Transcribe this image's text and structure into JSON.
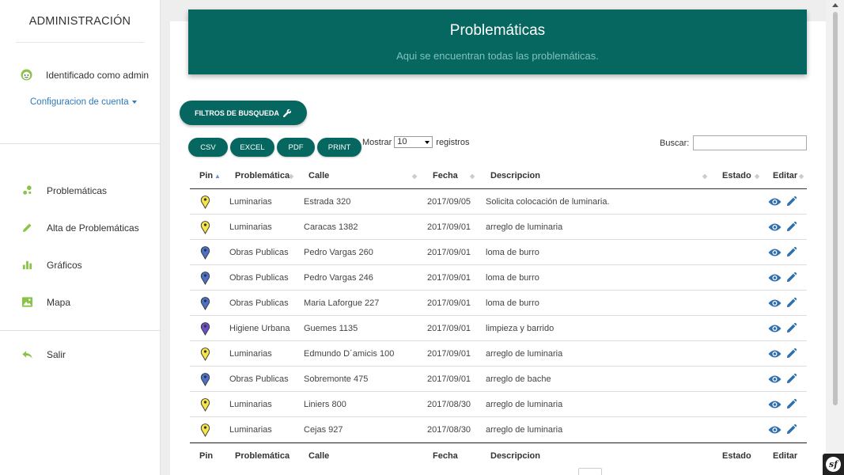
{
  "sidebar": {
    "brand": "ADMINISTRACIÓN",
    "user_label": "Identificado como admin",
    "config_label": "Configuracion de cuenta",
    "nav": [
      {
        "label": "Problemáticas",
        "icon": "dots-icon"
      },
      {
        "label": "Alta de Problemáticas",
        "icon": "pencil-icon"
      },
      {
        "label": "Gráficos",
        "icon": "bar-chart-icon"
      },
      {
        "label": "Mapa",
        "icon": "image-icon"
      }
    ],
    "logout_label": "Salir"
  },
  "header": {
    "title": "Problemáticas",
    "subtitle": "Aqui se encuentran todas las problemáticas."
  },
  "toolbar": {
    "filters_label": "FILTROS DE BUSQUEDA",
    "export_buttons": [
      "CSV",
      "EXCEL",
      "PDF",
      "PRINT"
    ],
    "show_prefix": "Mostrar",
    "show_value": "10",
    "show_suffix": "registros",
    "search_label": "Buscar:",
    "search_value": ""
  },
  "table": {
    "columns": [
      "Pin",
      "Problemática",
      "Calle",
      "Fecha",
      "Descripcion",
      "Estado",
      "Editar"
    ],
    "rows": [
      {
        "pin": "yellow",
        "problematica": "Luminarias",
        "calle": "Estrada 320",
        "fecha": "2017/09/05",
        "descripcion": "Solicita colocación de luminaria."
      },
      {
        "pin": "yellow",
        "problematica": "Luminarias",
        "calle": "Caracas 1382",
        "fecha": "2017/09/01",
        "descripcion": "arreglo de luminaria"
      },
      {
        "pin": "blue",
        "problematica": "Obras Publicas",
        "calle": "Pedro Vargas 260",
        "fecha": "2017/09/01",
        "descripcion": "loma de burro"
      },
      {
        "pin": "blue",
        "problematica": "Obras Publicas",
        "calle": "Pedro Vargas 246",
        "fecha": "2017/09/01",
        "descripcion": "loma de burro"
      },
      {
        "pin": "blue",
        "problematica": "Obras Publicas",
        "calle": "Maria Laforgue 227",
        "fecha": "2017/09/01",
        "descripcion": "loma de burro"
      },
      {
        "pin": "purple",
        "problematica": "Higiene Urbana",
        "calle": "Guemes 1135",
        "fecha": "2017/09/01",
        "descripcion": "limpieza y barrido"
      },
      {
        "pin": "yellow",
        "problematica": "Luminarias",
        "calle": "Edmundo D´amicis 100",
        "fecha": "2017/09/01",
        "descripcion": "arreglo de luminaria"
      },
      {
        "pin": "blue",
        "problematica": "Obras Publicas",
        "calle": "Sobremonte 475",
        "fecha": "2017/09/01",
        "descripcion": "arreglo de bache"
      },
      {
        "pin": "yellow",
        "problematica": "Luminarias",
        "calle": "Liniers 800",
        "fecha": "2017/08/30",
        "descripcion": "arreglo de luminaria"
      },
      {
        "pin": "yellow",
        "problematica": "Luminarias",
        "calle": "Cejas 927",
        "fecha": "2017/08/30",
        "descripcion": "arreglo de luminaria"
      }
    ]
  },
  "colors": {
    "primary": "#066660",
    "pin_yellow": "#f4e54a",
    "pin_blue": "#4a72c9",
    "pin_purple": "#6c4fc4",
    "action_blue": "#2f6fae",
    "sidebar_green": "#8bc34a"
  },
  "footer_badge": "sf"
}
